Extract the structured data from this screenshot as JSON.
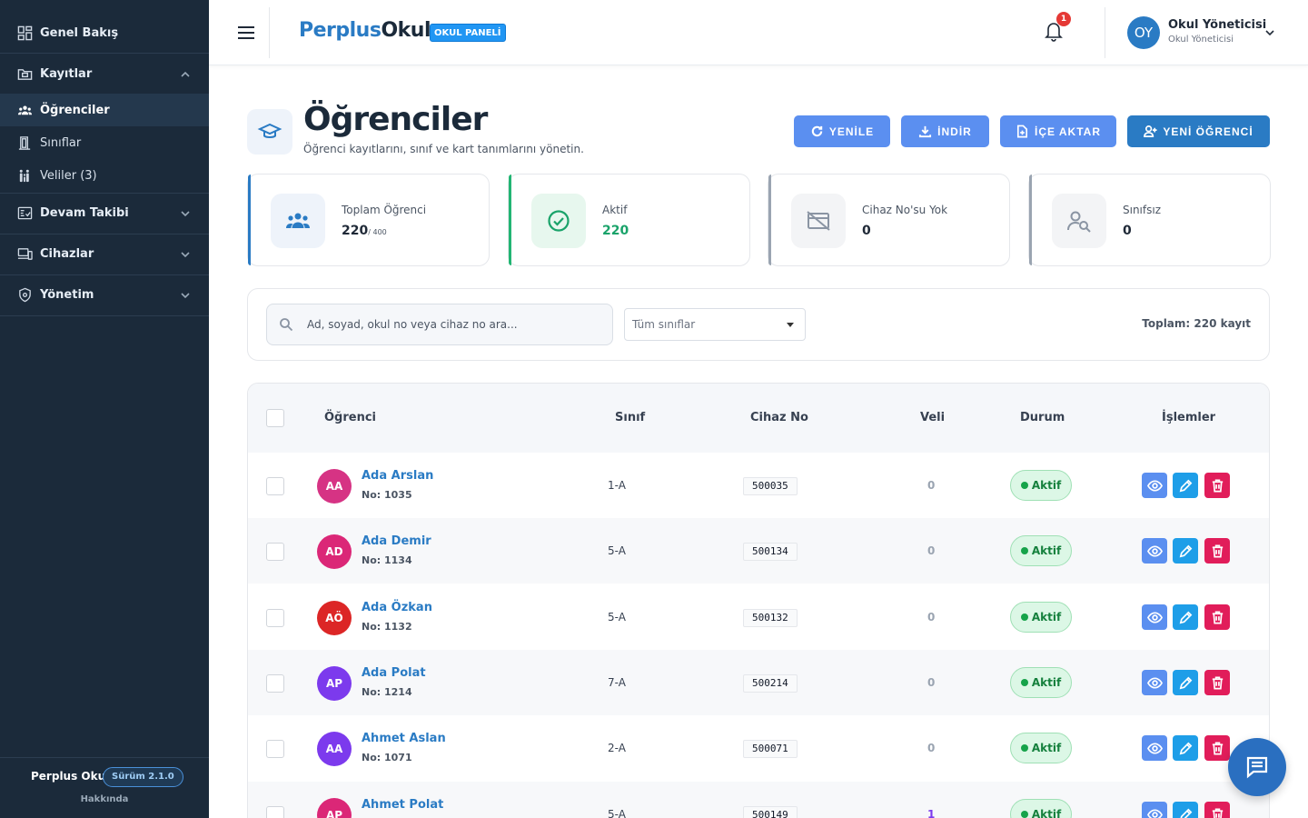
{
  "sidebar": {
    "items": [
      {
        "label": "Genel Bakış",
        "icon": "dashboard-icon"
      },
      {
        "label": "Kayıtlar",
        "icon": "folder-icon"
      },
      {
        "label": "Öğrenciler",
        "icon": "users-icon"
      },
      {
        "label": "Sınıflar",
        "icon": "door-icon"
      },
      {
        "label": "Veliler (3)",
        "icon": "family-icon"
      },
      {
        "label": "Devam Takibi",
        "icon": "attendance-icon"
      },
      {
        "label": "Cihazlar",
        "icon": "devices-icon"
      },
      {
        "label": "Yönetim",
        "icon": "settings-icon"
      }
    ],
    "footer": {
      "brand": "Perplus Okul",
      "version": "Sürüm 2.1.0",
      "about": "Hakkında"
    }
  },
  "header": {
    "logo_part1": "Perplus",
    "logo_part2": "Okul",
    "panel_badge": "OKUL PANELİ",
    "notification_count": "1",
    "user_initials": "OY",
    "user_name": "Okul Yöneticisi",
    "user_role": "Okul Yöneticisi"
  },
  "page": {
    "title": "Öğrenciler",
    "subtitle": "Öğrenci kayıtlarını, sınıf ve kart tanımlarını yönetin.",
    "buttons": {
      "refresh": "YENİLE",
      "download": "İNDİR",
      "import": "İÇE AKTAR",
      "new_student": "YENİ ÖĞRENCİ"
    }
  },
  "stats": [
    {
      "label": "Toplam Öğrenci",
      "value": "220",
      "suffix": "/ 400",
      "accent": "#2a7bc4"
    },
    {
      "label": "Aktif",
      "value": "220",
      "suffix": "",
      "accent": "#22b573"
    },
    {
      "label": "Cihaz No'su Yok",
      "value": "0",
      "suffix": "",
      "accent": "#9aa4b1"
    },
    {
      "label": "Sınıfsız",
      "value": "0",
      "suffix": "",
      "accent": "#9aa4b1"
    }
  ],
  "filter": {
    "search_placeholder": "Ad, soyad, okul no veya cihaz no ara...",
    "class_select": "Tüm sınıflar",
    "total": "Toplam: 220 kayıt"
  },
  "table": {
    "headers": {
      "student": "Öğrenci",
      "class": "Sınıf",
      "device": "Cihaz No",
      "parent": "Veli",
      "status": "Durum",
      "actions": "İşlemler"
    },
    "rows": [
      {
        "initials": "AA",
        "color": "#d63384",
        "name": "Ada Arslan",
        "no": "No: 1035",
        "class": "1-A",
        "device": "500035",
        "parent": "0",
        "status": "Aktif"
      },
      {
        "initials": "AD",
        "color": "#db2777",
        "name": "Ada Demir",
        "no": "No: 1134",
        "class": "5-A",
        "device": "500134",
        "parent": "0",
        "status": "Aktif"
      },
      {
        "initials": "AÖ",
        "color": "#dc2626",
        "name": "Ada Özkan",
        "no": "No: 1132",
        "class": "5-A",
        "device": "500132",
        "parent": "0",
        "status": "Aktif"
      },
      {
        "initials": "AP",
        "color": "#7c3aed",
        "name": "Ada Polat",
        "no": "No: 1214",
        "class": "7-A",
        "device": "500214",
        "parent": "0",
        "status": "Aktif"
      },
      {
        "initials": "AA",
        "color": "#7c3aed",
        "name": "Ahmet Aslan",
        "no": "No: 1071",
        "class": "2-A",
        "device": "500071",
        "parent": "0",
        "status": "Aktif"
      },
      {
        "initials": "AP",
        "color": "#db2777",
        "name": "Ahmet Polat",
        "no": "",
        "class": "5-A",
        "device": "500149",
        "parent": "1",
        "status": "Aktif"
      }
    ]
  }
}
